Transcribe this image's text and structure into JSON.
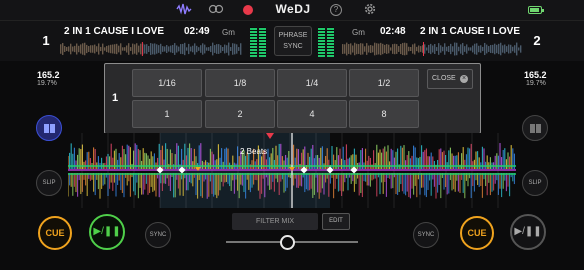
{
  "topbar": {
    "app_title": "WeDJ",
    "icons": [
      "waveform-icon",
      "headphones-icon",
      "record-icon",
      "help-icon",
      "settings-icon",
      "battery-icon"
    ]
  },
  "deck1": {
    "number": "1",
    "title": "2 IN 1 CAUSE I LOVE",
    "time": "02:49",
    "key": "Gm",
    "bpm": "165.2",
    "pitch": "19.7%"
  },
  "deck2": {
    "number": "2",
    "title": "2 IN 1 CAUSE I LOVE",
    "time": "02:48",
    "key": "Gm",
    "bpm": "165.2",
    "pitch": "19.7%"
  },
  "phrase_sync": {
    "line1": "PHRASE",
    "line2": "SYNC"
  },
  "beat_jump": {
    "deck": "1",
    "row1": [
      "1/16",
      "1/8",
      "1/4",
      "1/2"
    ],
    "row2": [
      "1",
      "2",
      "4",
      "8"
    ],
    "close_label": "CLOSE"
  },
  "waveform": {
    "beats_label": "2 Beats"
  },
  "controls": {
    "slip_label": "SLIP",
    "cue_label": "CUE",
    "play_label": "▶/❚❚",
    "sync_label": "SYNC",
    "filter_mix_label": "FILTER MIX",
    "edit_label": "EDIT"
  },
  "colors": {
    "accent_orange": "#f0a31e",
    "accent_green": "#4fd04a",
    "highlight_red": "#e8394a",
    "deck_blue": "#3b4fd6"
  }
}
